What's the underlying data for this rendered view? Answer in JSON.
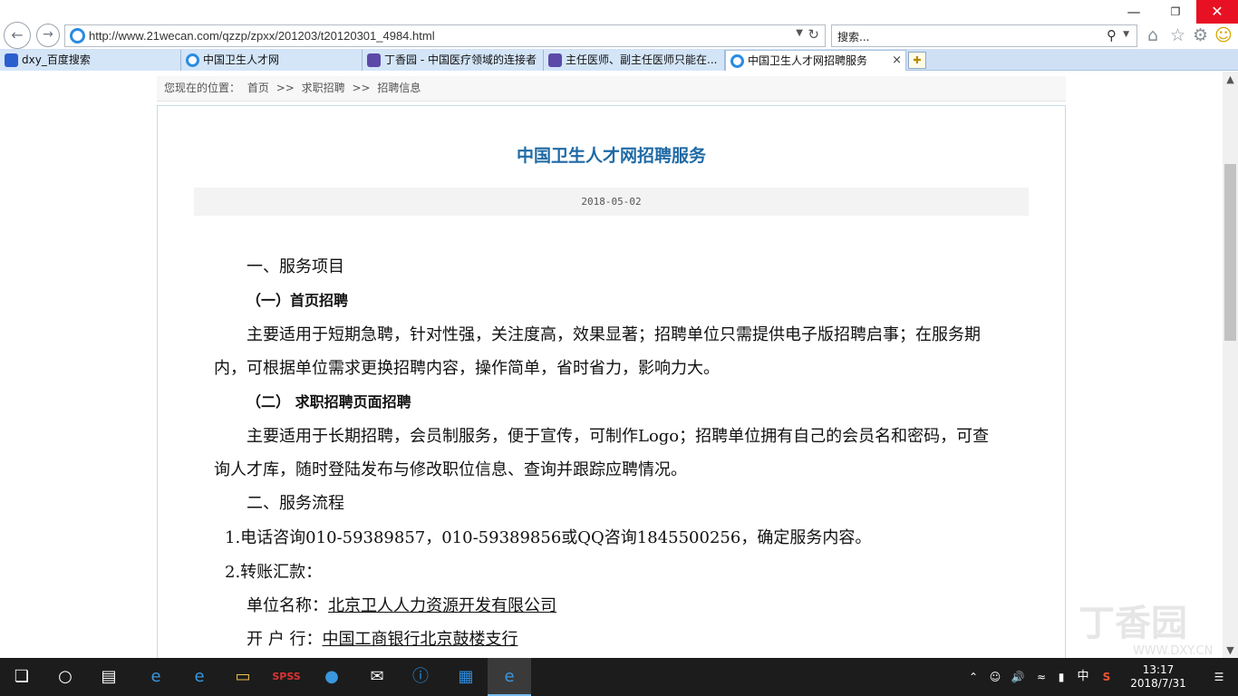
{
  "browser": {
    "url": "http://www.21wecan.com/qzzp/zpxx/201203/t20120301_4984.html",
    "search_placeholder": "搜索...",
    "tabs": [
      {
        "label": "dxy_百度搜索",
        "icon": "baidu-icon"
      },
      {
        "label": "中国卫生人才网",
        "icon": "ie-icon"
      },
      {
        "label": "丁香园 - 中国医疗领域的连接者",
        "icon": "dxy-icon"
      },
      {
        "label": "主任医师、副主任医师只能在...",
        "icon": "dxy-icon"
      },
      {
        "label": "中国卫生人才网招聘服务",
        "icon": "ie-icon"
      }
    ],
    "active_tab": 4,
    "tab_close": "×"
  },
  "breadcrumb": {
    "prefix": "您现在的位置：",
    "items": [
      "首页",
      "求职招聘",
      "招聘信息"
    ],
    "separator": ">>"
  },
  "article": {
    "title": "中国卫生人才网招聘服务",
    "date": "2018-05-02",
    "section1_heading": "一、服务项目",
    "sub1_heading": "（一）首页招聘",
    "sub1_para_line1": "主要适用于短期急聘，针对性强，关注度高，效果显著；招聘单位只需提供电子版招聘启事；在服务期",
    "sub1_para_line2": "内，可根据单位需求更换招聘内容，操作简单，省时省力，影响力大。",
    "sub2_heading": "（二）  求职招聘页面招聘",
    "sub2_para_line1": "主要适用于长期招聘，会员制服务，便于宣传，可制作Logo；招聘单位拥有自己的会员名和密码，可查",
    "sub2_para_line2": "询人才库，随时登陆发布与修改职位信息、查询并跟踪应聘情况。",
    "section2_heading": "二、服务流程",
    "step1": "1.电话咨询010-59389857，010-59389856或QQ咨询1845500256，确定服务内容。",
    "step2": "2.转账汇款：",
    "unit_label": "单位名称：",
    "unit_value": "北京卫人人力资源开发有限公司",
    "bank_label": "开 户 行：",
    "bank_value": "中国工商银行北京鼓楼支行"
  },
  "watermark": {
    "text": "丁香园",
    "url": "WWW.DXY.CN"
  },
  "taskbar": {
    "spss_label": "SPSS",
    "ime": "中",
    "time": "13:17",
    "date": "2018/7/31"
  }
}
